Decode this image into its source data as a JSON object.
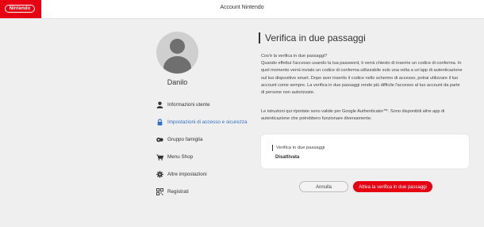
{
  "header": {
    "logo_text": "Nintendo",
    "title": "Account Nintendo",
    "brand_color": "#e60012"
  },
  "sidebar": {
    "username": "Danilo",
    "items": [
      {
        "label": "Informazioni utente",
        "icon": "person-icon",
        "active": false
      },
      {
        "label": "Impostazioni di accesso e sicurezza",
        "icon": "lock-icon",
        "active": true
      },
      {
        "label": "Gruppo famiglia",
        "icon": "family-icon",
        "active": false
      },
      {
        "label": "Menu Shop",
        "icon": "shop-icon",
        "active": false
      },
      {
        "label": "Altre impostazioni",
        "icon": "gear-icon",
        "active": false
      },
      {
        "label": "Registrati",
        "icon": "qr-code-icon",
        "active": false
      }
    ],
    "active_color": "#2f6ec8"
  },
  "main": {
    "title": "Verifica in due passaggi",
    "paragraph1": "Cos'è la verifica in due passaggi?\nQuando effettui l'accesso usando la tua password, ti verrà chiesto di inserire un codice di conferma. In\nquel momento verrà inviato un codice di conferma utilizzabile solo una volta a un'app di autenticazione\nsul tuo dispositivo smart. Dopo aver inserito il codice nello schermo di accesso, potrai utilizzare il tuo\naccount come sempre. La verifica in due passaggi rende più difficile l'accesso al tuo account da parte\ndi persone non autorizzate.",
    "paragraph2": "Le istruzioni qui riportate sono valide per Google Authenticator™. Sono disponibili altre app di\nautenticazione che potrebbero funzionare diversamente.",
    "status_card": {
      "label": "Verifica in due passaggi",
      "value": "Disattivata"
    },
    "cancel_label": "Annulla",
    "activate_label": "Attiva la verifica in due passaggi"
  }
}
